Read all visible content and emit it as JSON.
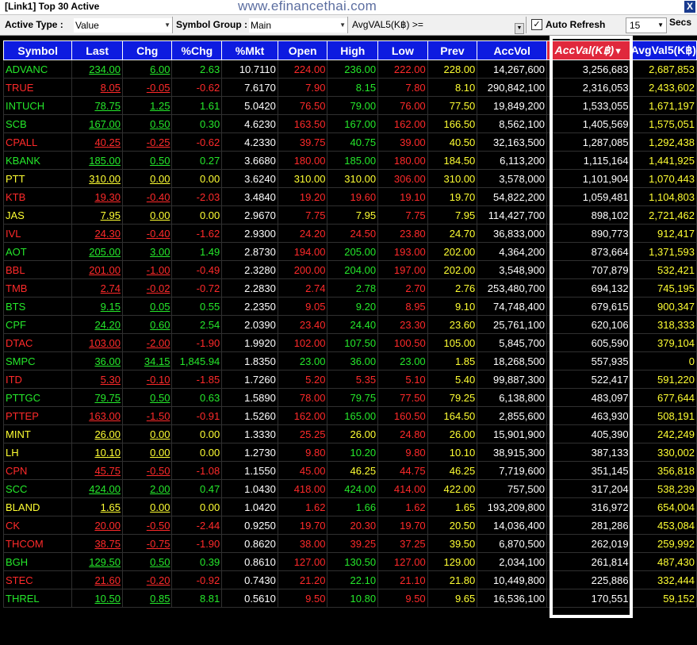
{
  "window": {
    "title": "[Link1] Top 30 Active",
    "watermark": "www.efinancethai.com",
    "close_label": "X"
  },
  "toolbar": {
    "active_type_label": "Active Type :",
    "active_type_value": "Value",
    "symbol_group_label": "Symbol Group :",
    "symbol_group_value": "Main",
    "avgval_label": "AvgVAL5(K฿) >=",
    "avgval_value": "",
    "auto_refresh_checked": true,
    "auto_refresh_label": "Auto Refresh",
    "refresh_seconds": "15",
    "secs_label": "Secs"
  },
  "colors": {
    "up": "#25e82b",
    "down": "#ff2a2a",
    "unchanged": "#ffff33",
    "header": "#0d1be0",
    "sort_header": "#e0283c"
  },
  "table": {
    "columns": [
      "Symbol",
      "Last",
      "Chg",
      "%Chg",
      "%Mkt",
      "Open",
      "High",
      "Low",
      "Prev",
      "AccVol",
      "AccVal(K฿)",
      "AvgVal5(K฿)"
    ],
    "sort_indicator": "▼",
    "rows": [
      {
        "symbol": "ADVANC",
        "last": "234.00",
        "chg": "6.00",
        "pchg": "2.63",
        "pmkt": "10.7110",
        "open": "224.00",
        "high": "236.00",
        "low": "222.00",
        "prev": "228.00",
        "accvol": "14,267,600",
        "accval": "3,256,683",
        "avgval5": "2,687,853",
        "c": "g",
        "co": "r",
        "ch": "g",
        "cl": "r",
        "cp": "y"
      },
      {
        "symbol": "TRUE",
        "last": "8.05",
        "chg": "-0.05",
        "pchg": "-0.62",
        "pmkt": "7.6170",
        "open": "7.90",
        "high": "8.15",
        "low": "7.80",
        "prev": "8.10",
        "accvol": "290,842,100",
        "accval": "2,316,053",
        "avgval5": "2,433,602",
        "c": "r",
        "co": "r",
        "ch": "g",
        "cl": "r",
        "cp": "y"
      },
      {
        "symbol": "INTUCH",
        "last": "78.75",
        "chg": "1.25",
        "pchg": "1.61",
        "pmkt": "5.0420",
        "open": "76.50",
        "high": "79.00",
        "low": "76.00",
        "prev": "77.50",
        "accvol": "19,849,200",
        "accval": "1,533,055",
        "avgval5": "1,671,197",
        "c": "g",
        "co": "r",
        "ch": "g",
        "cl": "r",
        "cp": "y"
      },
      {
        "symbol": "SCB",
        "last": "167.00",
        "chg": "0.50",
        "pchg": "0.30",
        "pmkt": "4.6230",
        "open": "163.50",
        "high": "167.00",
        "low": "162.00",
        "prev": "166.50",
        "accvol": "8,562,100",
        "accval": "1,405,569",
        "avgval5": "1,575,051",
        "c": "g",
        "co": "r",
        "ch": "g",
        "cl": "r",
        "cp": "y"
      },
      {
        "symbol": "CPALL",
        "last": "40.25",
        "chg": "-0.25",
        "pchg": "-0.62",
        "pmkt": "4.2330",
        "open": "39.75",
        "high": "40.75",
        "low": "39.00",
        "prev": "40.50",
        "accvol": "32,163,500",
        "accval": "1,287,085",
        "avgval5": "1,292,438",
        "c": "r",
        "co": "r",
        "ch": "g",
        "cl": "r",
        "cp": "y"
      },
      {
        "symbol": "KBANK",
        "last": "185.00",
        "chg": "0.50",
        "pchg": "0.27",
        "pmkt": "3.6680",
        "open": "180.00",
        "high": "185.00",
        "low": "180.00",
        "prev": "184.50",
        "accvol": "6,113,200",
        "accval": "1,115,164",
        "avgval5": "1,441,925",
        "c": "g",
        "co": "r",
        "ch": "g",
        "cl": "r",
        "cp": "y"
      },
      {
        "symbol": "PTT",
        "last": "310.00",
        "chg": "0.00",
        "pchg": "0.00",
        "pmkt": "3.6240",
        "open": "310.00",
        "high": "310.00",
        "low": "306.00",
        "prev": "310.00",
        "accvol": "3,578,000",
        "accval": "1,101,904",
        "avgval5": "1,070,443",
        "c": "y",
        "co": "y",
        "ch": "y",
        "cl": "r",
        "cp": "y"
      },
      {
        "symbol": "KTB",
        "last": "19.30",
        "chg": "-0.40",
        "pchg": "-2.03",
        "pmkt": "3.4840",
        "open": "19.20",
        "high": "19.60",
        "low": "19.10",
        "prev": "19.70",
        "accvol": "54,822,200",
        "accval": "1,059,481",
        "avgval5": "1,104,803",
        "c": "r",
        "co": "r",
        "ch": "r",
        "cl": "r",
        "cp": "y"
      },
      {
        "symbol": "JAS",
        "last": "7.95",
        "chg": "0.00",
        "pchg": "0.00",
        "pmkt": "2.9670",
        "open": "7.75",
        "high": "7.95",
        "low": "7.75",
        "prev": "7.95",
        "accvol": "114,427,700",
        "accval": "898,102",
        "avgval5": "2,721,462",
        "c": "y",
        "co": "r",
        "ch": "y",
        "cl": "r",
        "cp": "y"
      },
      {
        "symbol": "IVL",
        "last": "24.30",
        "chg": "-0.40",
        "pchg": "-1.62",
        "pmkt": "2.9300",
        "open": "24.20",
        "high": "24.50",
        "low": "23.80",
        "prev": "24.70",
        "accvol": "36,833,000",
        "accval": "890,773",
        "avgval5": "912,417",
        "c": "r",
        "co": "r",
        "ch": "r",
        "cl": "r",
        "cp": "y"
      },
      {
        "symbol": "AOT",
        "last": "205.00",
        "chg": "3.00",
        "pchg": "1.49",
        "pmkt": "2.8730",
        "open": "194.00",
        "high": "205.00",
        "low": "193.00",
        "prev": "202.00",
        "accvol": "4,364,200",
        "accval": "873,664",
        "avgval5": "1,371,593",
        "c": "g",
        "co": "r",
        "ch": "g",
        "cl": "r",
        "cp": "y"
      },
      {
        "symbol": "BBL",
        "last": "201.00",
        "chg": "-1.00",
        "pchg": "-0.49",
        "pmkt": "2.3280",
        "open": "200.00",
        "high": "204.00",
        "low": "197.00",
        "prev": "202.00",
        "accvol": "3,548,900",
        "accval": "707,879",
        "avgval5": "532,421",
        "c": "r",
        "co": "r",
        "ch": "g",
        "cl": "r",
        "cp": "y"
      },
      {
        "symbol": "TMB",
        "last": "2.74",
        "chg": "-0.02",
        "pchg": "-0.72",
        "pmkt": "2.2830",
        "open": "2.74",
        "high": "2.78",
        "low": "2.70",
        "prev": "2.76",
        "accvol": "253,480,700",
        "accval": "694,132",
        "avgval5": "745,195",
        "c": "r",
        "co": "r",
        "ch": "g",
        "cl": "r",
        "cp": "y"
      },
      {
        "symbol": "BTS",
        "last": "9.15",
        "chg": "0.05",
        "pchg": "0.55",
        "pmkt": "2.2350",
        "open": "9.05",
        "high": "9.20",
        "low": "8.95",
        "prev": "9.10",
        "accvol": "74,748,400",
        "accval": "679,615",
        "avgval5": "900,347",
        "c": "g",
        "co": "r",
        "ch": "g",
        "cl": "r",
        "cp": "y"
      },
      {
        "symbol": "CPF",
        "last": "24.20",
        "chg": "0.60",
        "pchg": "2.54",
        "pmkt": "2.0390",
        "open": "23.40",
        "high": "24.40",
        "low": "23.30",
        "prev": "23.60",
        "accvol": "25,761,100",
        "accval": "620,106",
        "avgval5": "318,333",
        "c": "g",
        "co": "r",
        "ch": "g",
        "cl": "r",
        "cp": "y"
      },
      {
        "symbol": "DTAC",
        "last": "103.00",
        "chg": "-2.00",
        "pchg": "-1.90",
        "pmkt": "1.9920",
        "open": "102.00",
        "high": "107.50",
        "low": "100.50",
        "prev": "105.00",
        "accvol": "5,845,700",
        "accval": "605,590",
        "avgval5": "379,104",
        "c": "r",
        "co": "r",
        "ch": "g",
        "cl": "r",
        "cp": "y"
      },
      {
        "symbol": "SMPC",
        "last": "36.00",
        "chg": "34.15",
        "pchg": "1,845.94",
        "pmkt": "1.8350",
        "open": "23.00",
        "high": "36.00",
        "low": "23.00",
        "prev": "1.85",
        "accvol": "18,268,500",
        "accval": "557,935",
        "avgval5": "0",
        "c": "g",
        "co": "g",
        "ch": "g",
        "cl": "g",
        "cp": "y"
      },
      {
        "symbol": "ITD",
        "last": "5.30",
        "chg": "-0.10",
        "pchg": "-1.85",
        "pmkt": "1.7260",
        "open": "5.20",
        "high": "5.35",
        "low": "5.10",
        "prev": "5.40",
        "accvol": "99,887,300",
        "accval": "522,417",
        "avgval5": "591,220",
        "c": "r",
        "co": "r",
        "ch": "r",
        "cl": "r",
        "cp": "y"
      },
      {
        "symbol": "PTTGC",
        "last": "79.75",
        "chg": "0.50",
        "pchg": "0.63",
        "pmkt": "1.5890",
        "open": "78.00",
        "high": "79.75",
        "low": "77.50",
        "prev": "79.25",
        "accvol": "6,138,800",
        "accval": "483,097",
        "avgval5": "677,644",
        "c": "g",
        "co": "r",
        "ch": "g",
        "cl": "r",
        "cp": "y"
      },
      {
        "symbol": "PTTEP",
        "last": "163.00",
        "chg": "-1.50",
        "pchg": "-0.91",
        "pmkt": "1.5260",
        "open": "162.00",
        "high": "165.00",
        "low": "160.50",
        "prev": "164.50",
        "accvol": "2,855,600",
        "accval": "463,930",
        "avgval5": "508,191",
        "c": "r",
        "co": "r",
        "ch": "g",
        "cl": "r",
        "cp": "y"
      },
      {
        "symbol": "MINT",
        "last": "26.00",
        "chg": "0.00",
        "pchg": "0.00",
        "pmkt": "1.3330",
        "open": "25.25",
        "high": "26.00",
        "low": "24.80",
        "prev": "26.00",
        "accvol": "15,901,900",
        "accval": "405,390",
        "avgval5": "242,249",
        "c": "y",
        "co": "r",
        "ch": "y",
        "cl": "r",
        "cp": "y"
      },
      {
        "symbol": "LH",
        "last": "10.10",
        "chg": "0.00",
        "pchg": "0.00",
        "pmkt": "1.2730",
        "open": "9.80",
        "high": "10.20",
        "low": "9.80",
        "prev": "10.10",
        "accvol": "38,915,300",
        "accval": "387,133",
        "avgval5": "330,002",
        "c": "y",
        "co": "r",
        "ch": "g",
        "cl": "r",
        "cp": "y"
      },
      {
        "symbol": "CPN",
        "last": "45.75",
        "chg": "-0.50",
        "pchg": "-1.08",
        "pmkt": "1.1550",
        "open": "45.00",
        "high": "46.25",
        "low": "44.75",
        "prev": "46.25",
        "accvol": "7,719,600",
        "accval": "351,145",
        "avgval5": "356,818",
        "c": "r",
        "co": "r",
        "ch": "y",
        "cl": "r",
        "cp": "y"
      },
      {
        "symbol": "SCC",
        "last": "424.00",
        "chg": "2.00",
        "pchg": "0.47",
        "pmkt": "1.0430",
        "open": "418.00",
        "high": "424.00",
        "low": "414.00",
        "prev": "422.00",
        "accvol": "757,500",
        "accval": "317,204",
        "avgval5": "538,239",
        "c": "g",
        "co": "r",
        "ch": "g",
        "cl": "r",
        "cp": "y"
      },
      {
        "symbol": "BLAND",
        "last": "1.65",
        "chg": "0.00",
        "pchg": "0.00",
        "pmkt": "1.0420",
        "open": "1.62",
        "high": "1.66",
        "low": "1.62",
        "prev": "1.65",
        "accvol": "193,209,800",
        "accval": "316,972",
        "avgval5": "654,004",
        "c": "y",
        "co": "r",
        "ch": "g",
        "cl": "r",
        "cp": "y"
      },
      {
        "symbol": "CK",
        "last": "20.00",
        "chg": "-0.50",
        "pchg": "-2.44",
        "pmkt": "0.9250",
        "open": "19.70",
        "high": "20.30",
        "low": "19.70",
        "prev": "20.50",
        "accvol": "14,036,400",
        "accval": "281,286",
        "avgval5": "453,084",
        "c": "r",
        "co": "r",
        "ch": "r",
        "cl": "r",
        "cp": "y"
      },
      {
        "symbol": "THCOM",
        "last": "38.75",
        "chg": "-0.75",
        "pchg": "-1.90",
        "pmkt": "0.8620",
        "open": "38.00",
        "high": "39.25",
        "low": "37.25",
        "prev": "39.50",
        "accvol": "6,870,500",
        "accval": "262,019",
        "avgval5": "259,992",
        "c": "r",
        "co": "r",
        "ch": "r",
        "cl": "r",
        "cp": "y"
      },
      {
        "symbol": "BGH",
        "last": "129.50",
        "chg": "0.50",
        "pchg": "0.39",
        "pmkt": "0.8610",
        "open": "127.00",
        "high": "130.50",
        "low": "127.00",
        "prev": "129.00",
        "accvol": "2,034,100",
        "accval": "261,814",
        "avgval5": "487,430",
        "c": "g",
        "co": "r",
        "ch": "g",
        "cl": "r",
        "cp": "y"
      },
      {
        "symbol": "STEC",
        "last": "21.60",
        "chg": "-0.20",
        "pchg": "-0.92",
        "pmkt": "0.7430",
        "open": "21.20",
        "high": "22.10",
        "low": "21.10",
        "prev": "21.80",
        "accvol": "10,449,800",
        "accval": "225,886",
        "avgval5": "332,444",
        "c": "r",
        "co": "r",
        "ch": "g",
        "cl": "r",
        "cp": "y"
      },
      {
        "symbol": "THREL",
        "last": "10.50",
        "chg": "0.85",
        "pchg": "8.81",
        "pmkt": "0.5610",
        "open": "9.50",
        "high": "10.80",
        "low": "9.50",
        "prev": "9.65",
        "accvol": "16,536,100",
        "accval": "170,551",
        "avgval5": "59,152",
        "c": "g",
        "co": "r",
        "ch": "g",
        "cl": "r",
        "cp": "y"
      }
    ]
  }
}
